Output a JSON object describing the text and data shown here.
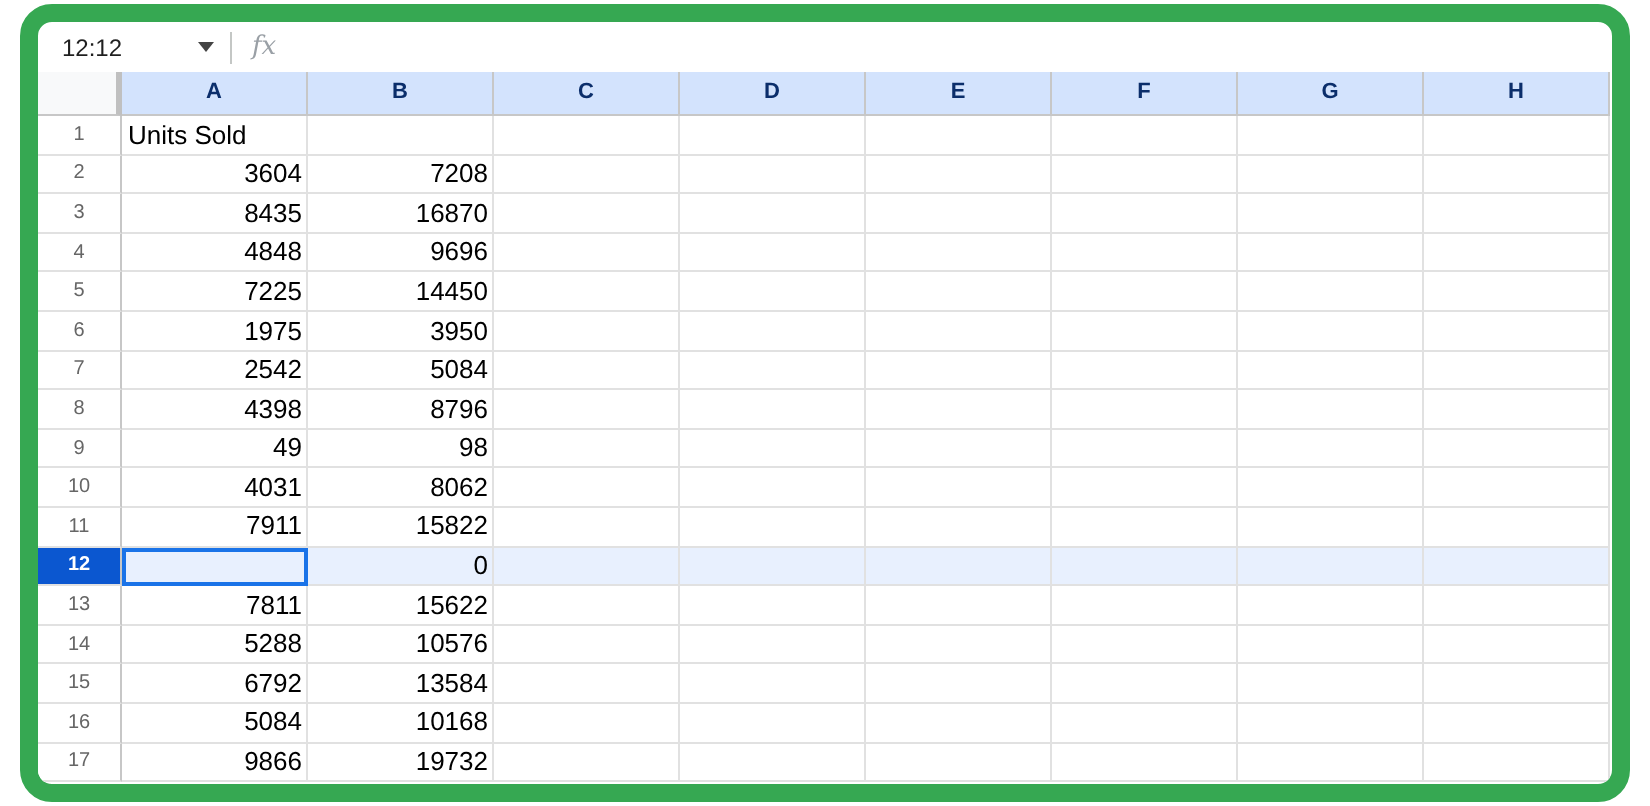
{
  "name_box": {
    "value": "12:12"
  },
  "formula_bar": {
    "label": "fx"
  },
  "columns": [
    {
      "label": "A",
      "highlighted": true
    },
    {
      "label": "B",
      "highlighted": true
    },
    {
      "label": "C",
      "highlighted": true
    },
    {
      "label": "D",
      "highlighted": true
    },
    {
      "label": "E",
      "highlighted": true
    },
    {
      "label": "F",
      "highlighted": true
    },
    {
      "label": "G",
      "highlighted": true
    },
    {
      "label": "H",
      "highlighted": true
    }
  ],
  "rows": [
    {
      "number": "1",
      "selected": false,
      "cells": [
        {
          "kind": "text",
          "text": "Units Sold",
          "active": false
        },
        {
          "kind": "text",
          "active": false
        }
      ]
    },
    {
      "number": "2",
      "selected": false,
      "cells": [
        {
          "kind": "number",
          "text": "3604",
          "active": false
        },
        {
          "kind": "number",
          "text": "7208",
          "active": false
        }
      ]
    },
    {
      "number": "3",
      "selected": false,
      "cells": [
        {
          "kind": "number",
          "text": "8435",
          "active": false
        },
        {
          "kind": "number",
          "text": "16870",
          "active": false
        }
      ]
    },
    {
      "number": "4",
      "selected": false,
      "cells": [
        {
          "kind": "number",
          "text": "4848",
          "active": false
        },
        {
          "kind": "number",
          "text": "9696",
          "active": false
        }
      ]
    },
    {
      "number": "5",
      "selected": false,
      "cells": [
        {
          "kind": "number",
          "text": "7225",
          "active": false
        },
        {
          "kind": "number",
          "text": "14450",
          "active": false
        }
      ]
    },
    {
      "number": "6",
      "selected": false,
      "cells": [
        {
          "kind": "number",
          "text": "1975",
          "active": false
        },
        {
          "kind": "number",
          "text": "3950",
          "active": false
        }
      ]
    },
    {
      "number": "7",
      "selected": false,
      "cells": [
        {
          "kind": "number",
          "text": "2542",
          "active": false
        },
        {
          "kind": "number",
          "text": "5084",
          "active": false
        }
      ]
    },
    {
      "number": "8",
      "selected": false,
      "cells": [
        {
          "kind": "number",
          "text": "4398",
          "active": false
        },
        {
          "kind": "number",
          "text": "8796",
          "active": false
        }
      ]
    },
    {
      "number": "9",
      "selected": false,
      "cells": [
        {
          "kind": "number",
          "text": "49",
          "active": false
        },
        {
          "kind": "number",
          "text": "98",
          "active": false
        }
      ]
    },
    {
      "number": "10",
      "selected": false,
      "cells": [
        {
          "kind": "number",
          "text": "4031",
          "active": false
        },
        {
          "kind": "number",
          "text": "8062",
          "active": false
        }
      ]
    },
    {
      "number": "11",
      "selected": false,
      "cells": [
        {
          "kind": "number",
          "text": "7911",
          "active": false
        },
        {
          "kind": "number",
          "text": "15822",
          "active": false
        }
      ]
    },
    {
      "number": "12",
      "selected": true,
      "cells": [
        {
          "kind": "number",
          "active": true
        },
        {
          "kind": "number",
          "text": "0",
          "active": false
        }
      ]
    },
    {
      "number": "13",
      "selected": false,
      "cells": [
        {
          "kind": "number",
          "text": "7811",
          "active": false
        },
        {
          "kind": "number",
          "text": "15622",
          "active": false
        }
      ]
    },
    {
      "number": "14",
      "selected": false,
      "cells": [
        {
          "kind": "number",
          "text": "5288",
          "active": false
        },
        {
          "kind": "number",
          "text": "10576",
          "active": false
        }
      ]
    },
    {
      "number": "15",
      "selected": false,
      "cells": [
        {
          "kind": "number",
          "text": "6792",
          "active": false
        },
        {
          "kind": "number",
          "text": "13584",
          "active": false
        }
      ]
    },
    {
      "number": "16",
      "selected": false,
      "cells": [
        {
          "kind": "number",
          "text": "5084",
          "active": false
        },
        {
          "kind": "number",
          "text": "10168",
          "active": false
        }
      ]
    },
    {
      "number": "17",
      "selected": false,
      "cells": [
        {
          "kind": "number",
          "text": "9866",
          "active": false
        },
        {
          "kind": "number",
          "text": "19732",
          "active": false
        }
      ]
    }
  ]
}
